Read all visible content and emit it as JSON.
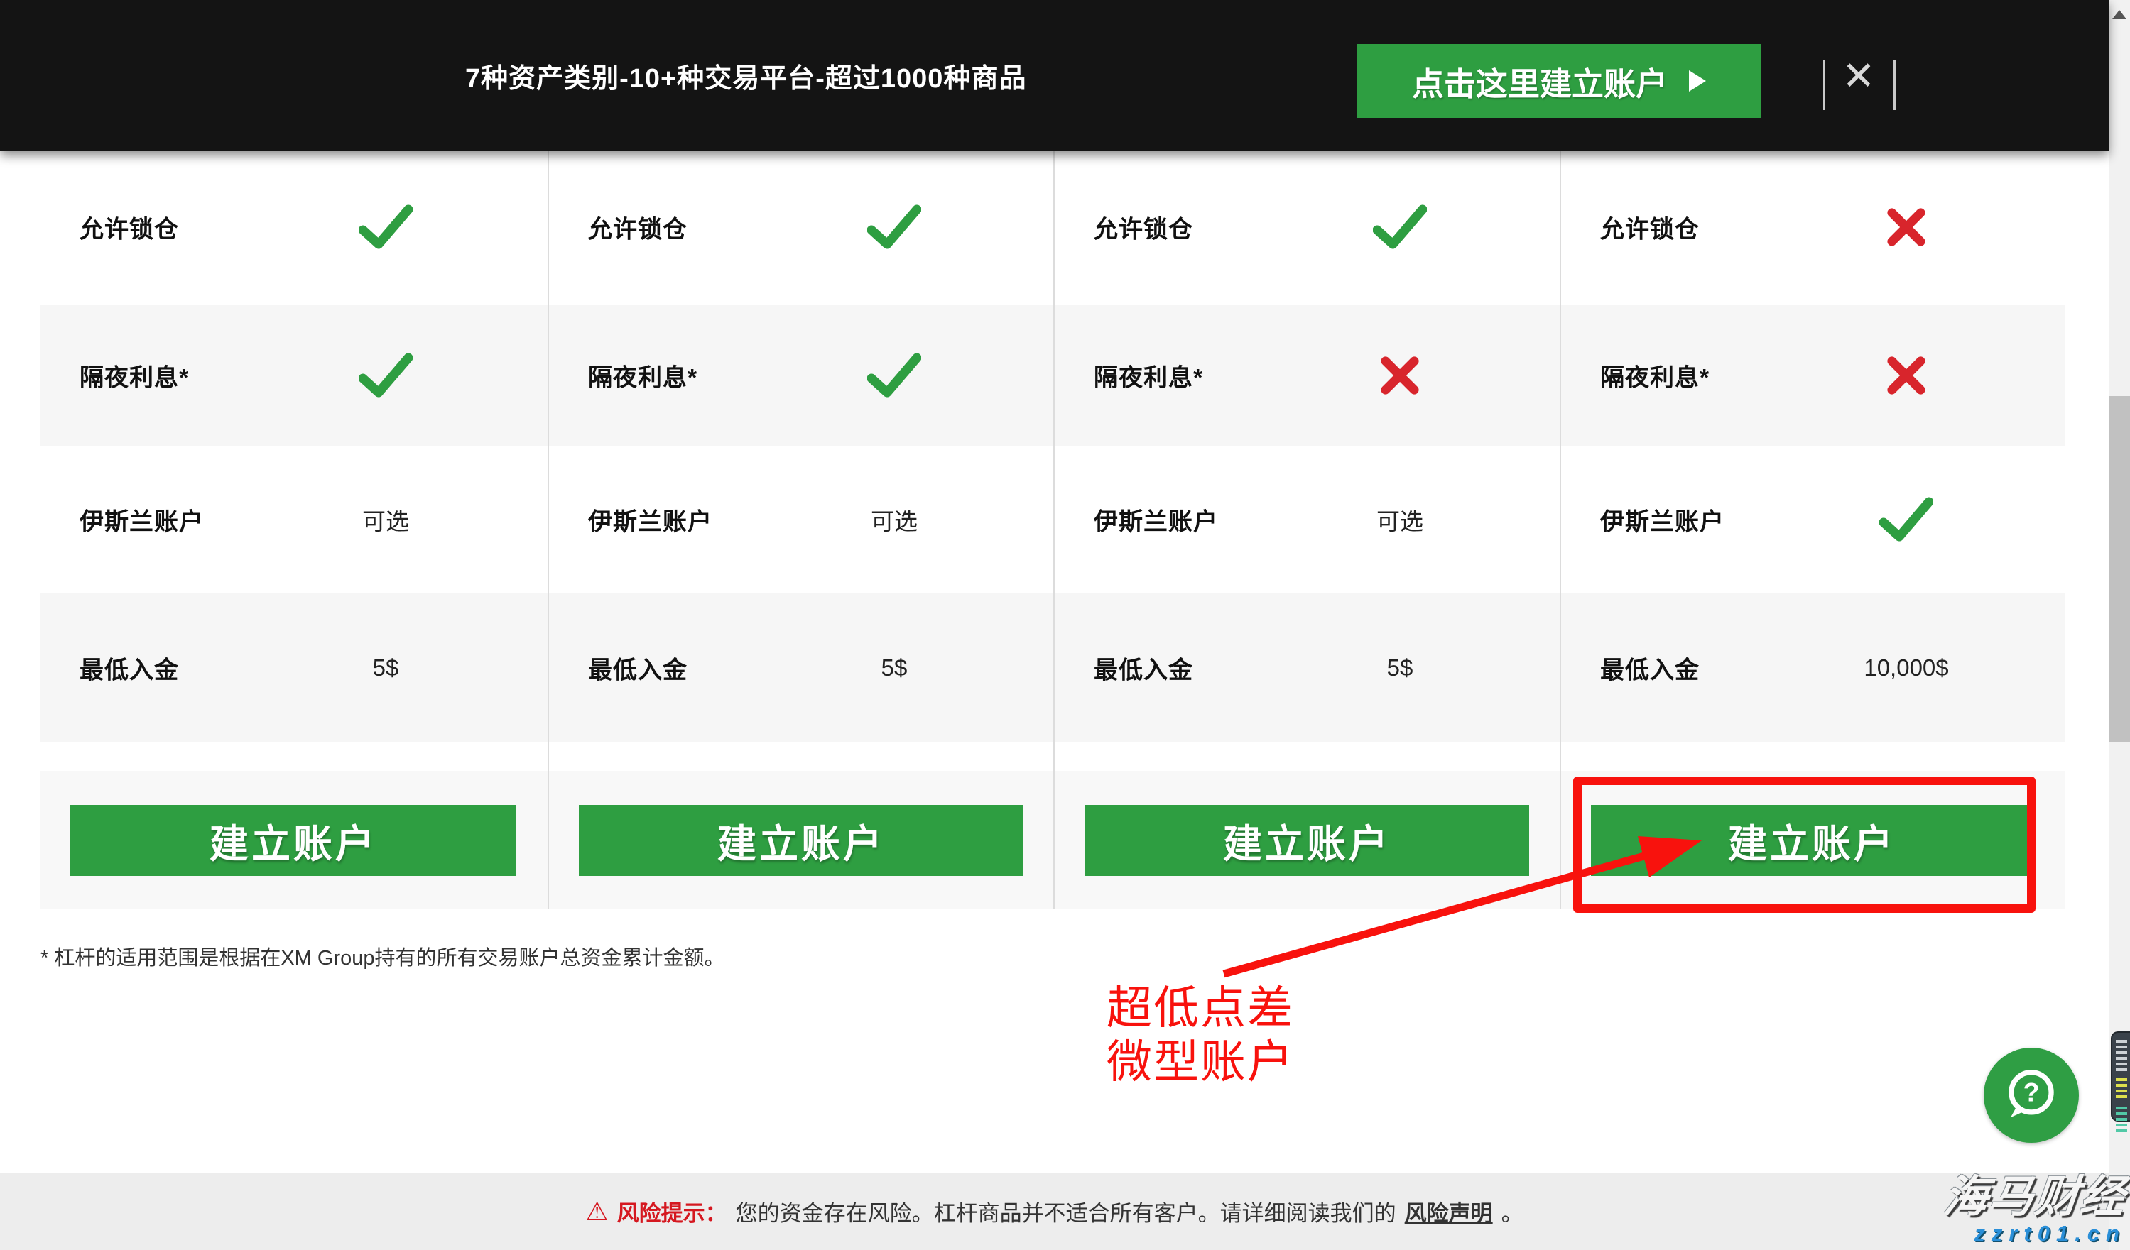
{
  "topbar": {
    "title": "7种资产类别-10+种交易平台-超过1000种商品",
    "cta": {
      "label": "点击这里建立账户",
      "arrow_icon": "play-arrow-icon"
    },
    "close_icon": "✕"
  },
  "table": {
    "row_labels": [
      "允许锁仓",
      "隔夜利息*",
      "伊斯兰账户",
      "最低入金"
    ],
    "columns": [
      {
        "values": [
          {
            "icon": "check-icon"
          },
          {
            "icon": "check-icon"
          },
          {
            "text": "可选"
          },
          {
            "text": "5$"
          }
        ],
        "button_label": "建立账户",
        "highlighted": false
      },
      {
        "values": [
          {
            "icon": "check-icon"
          },
          {
            "icon": "check-icon"
          },
          {
            "text": "可选"
          },
          {
            "text": "5$"
          }
        ],
        "button_label": "建立账户",
        "highlighted": false
      },
      {
        "values": [
          {
            "icon": "check-icon"
          },
          {
            "icon": "cross-icon"
          },
          {
            "text": "可选"
          },
          {
            "text": "5$"
          }
        ],
        "button_label": "建立账户",
        "highlighted": false
      },
      {
        "values": [
          {
            "icon": "cross-icon"
          },
          {
            "icon": "cross-icon"
          },
          {
            "icon": "check-icon"
          },
          {
            "text": "10,000$"
          }
        ],
        "button_label": "建立账户",
        "highlighted": true
      }
    ]
  },
  "footnote": "* 杠杆的适用范围是根据在XM Group持有的所有交易账户总资金累计金额。",
  "annotation": {
    "lines": [
      "超低点差",
      "微型账户"
    ]
  },
  "risk_bar": {
    "warning_icon": "⚠",
    "label": "风险提示：",
    "text": "您的资金存在风险。杠杆商品并不适合所有客户。请详细阅读我们的",
    "link": "风险声明",
    "suffix": "。"
  },
  "watermark": {
    "name": "海马财经",
    "site": "zzrt01.cn"
  },
  "chat_button": {
    "glyph": "?"
  },
  "colors": {
    "topbar_black": "#141414",
    "accent_green": "#2e9e41",
    "check_green": "#2e9e41",
    "cross_red": "#d8252c",
    "highlight_red": "#f8120d",
    "risk_red": "#d51820",
    "watermark_blue": "#2a8fd8",
    "row_gray": "#f6f6f6"
  }
}
